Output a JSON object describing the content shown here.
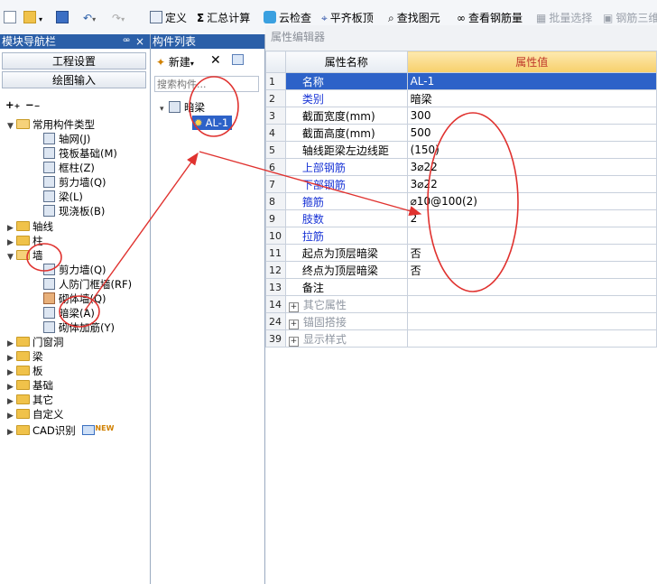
{
  "toolbar": {
    "items": [
      "定义",
      "汇总计算",
      "云检查",
      "平齐板顶",
      "查找图元",
      "查看钢筋量",
      "批量选择",
      "钢筋三维"
    ]
  },
  "nav": {
    "title": "模块导航栏",
    "pin": "ꟹ",
    "close": "×",
    "project_settings": "工程设置",
    "drawing_input": "绘图输入",
    "tree": {
      "common_types": "常用构件类型",
      "common_children": [
        "轴网(J)",
        "筏板基础(M)",
        "框柱(Z)",
        "剪力墙(Q)",
        "梁(L)",
        "现浇板(B)"
      ],
      "axis": "轴线",
      "column": "柱",
      "wall": "墙",
      "wall_children": [
        "剪力墙(Q)",
        "人防门框墙(RF)",
        "砌体墙(Q)",
        "暗梁(A)",
        "砌体加筋(Y)"
      ],
      "folders": [
        "门窗洞",
        "梁",
        "板",
        "基础",
        "其它",
        "自定义",
        "CAD识别"
      ],
      "new_badge": "NEW"
    }
  },
  "component_list": {
    "title": "构件列表",
    "new_label": "新建",
    "search_placeholder": "搜索构件...",
    "category": "暗梁",
    "item": "AL-1"
  },
  "property_editor": {
    "title": "属性编辑器",
    "col_name": "属性名称",
    "col_value": "属性值",
    "rows": [
      {
        "num": "1",
        "name": "名称",
        "value": "AL-1"
      },
      {
        "num": "2",
        "name": "类别",
        "value": "暗梁"
      },
      {
        "num": "3",
        "name": "截面宽度(mm)",
        "value": "300"
      },
      {
        "num": "4",
        "name": "截面高度(mm)",
        "value": "500"
      },
      {
        "num": "5",
        "name": "轴线距梁左边线距",
        "value": "(150)"
      },
      {
        "num": "6",
        "name": "上部钢筋",
        "value": "3⌀22"
      },
      {
        "num": "7",
        "name": "下部钢筋",
        "value": "3⌀22"
      },
      {
        "num": "8",
        "name": "箍筋",
        "value": "⌀10@100(2)"
      },
      {
        "num": "9",
        "name": "肢数",
        "value": "2"
      },
      {
        "num": "10",
        "name": "拉筋",
        "value": ""
      },
      {
        "num": "11",
        "name": "起点为顶层暗梁",
        "value": "否"
      },
      {
        "num": "12",
        "name": "终点为顶层暗梁",
        "value": "否"
      },
      {
        "num": "13",
        "name": "备注",
        "value": ""
      },
      {
        "num": "14",
        "name": "其它属性",
        "value": ""
      },
      {
        "num": "24",
        "name": "锚固搭接",
        "value": ""
      },
      {
        "num": "39",
        "name": "显示样式",
        "value": ""
      }
    ]
  },
  "colors": {
    "annotation": "#e0322f",
    "selection": "#2d62c8",
    "value_header": "#c0392b"
  }
}
